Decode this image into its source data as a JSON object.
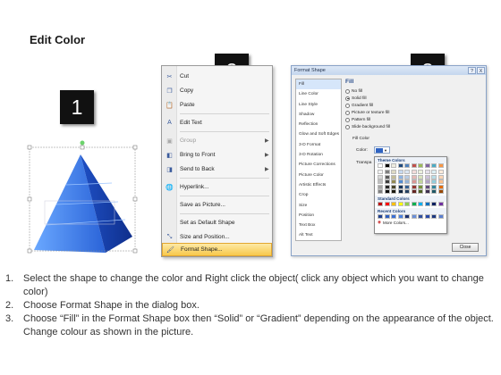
{
  "title": "Edit Color",
  "steps": {
    "one": "1",
    "two": "2",
    "three": "3"
  },
  "context_menu": {
    "items": [
      {
        "label": "Cut",
        "icon": "scissors-icon",
        "disabled": false,
        "submenu": false
      },
      {
        "label": "Copy",
        "icon": "copy-icon",
        "disabled": false,
        "submenu": false
      },
      {
        "label": "Paste",
        "icon": "paste-icon",
        "disabled": false,
        "submenu": false
      },
      {
        "label": "Edit Text",
        "icon": "edit-text-icon",
        "disabled": false,
        "submenu": false
      },
      {
        "label": "Group",
        "icon": "group-icon",
        "disabled": true,
        "submenu": true
      },
      {
        "label": "Bring to Front",
        "icon": "bring-front-icon",
        "disabled": false,
        "submenu": true
      },
      {
        "label": "Send to Back",
        "icon": "send-back-icon",
        "disabled": false,
        "submenu": true
      },
      {
        "label": "Hyperlink...",
        "icon": "hyperlink-icon",
        "disabled": false,
        "submenu": false
      },
      {
        "label": "Save as Picture...",
        "icon": "",
        "disabled": false,
        "submenu": false
      },
      {
        "label": "Set as Default Shape",
        "icon": "",
        "disabled": false,
        "submenu": false
      },
      {
        "label": "Size and Position...",
        "icon": "size-position-icon",
        "disabled": false,
        "submenu": false
      },
      {
        "label": "Format Shape...",
        "icon": "format-shape-icon",
        "disabled": false,
        "submenu": false,
        "highlighted": true
      }
    ]
  },
  "dialog": {
    "title": "Format Shape",
    "help_btn": "?",
    "close_btn": "X",
    "nav": [
      "Fill",
      "Line Color",
      "Line Style",
      "Shadow",
      "Reflection",
      "Glow and Soft Edges",
      "3-D Format",
      "3-D Rotation",
      "Picture Corrections",
      "Picture Color",
      "Artistic Effects",
      "Crop",
      "Size",
      "Position",
      "Text Box",
      "Alt Text"
    ],
    "fill_heading": "Fill",
    "fill_options": [
      "No fill",
      "Solid fill",
      "Gradient fill",
      "Picture or texture fill",
      "Pattern fill",
      "Slide background fill"
    ],
    "fill_selected": 1,
    "fill_color_group": "Fill Color",
    "color_label": "Color:",
    "transparency_label": "Transpa",
    "palette": {
      "theme_heading": "Theme Colors",
      "standard_heading": "Standard Colors",
      "recent_heading": "Recent Colors",
      "more_label": "More Colors...",
      "theme_top": [
        "#ffffff",
        "#000000",
        "#eeece1",
        "#1f497d",
        "#4f81bd",
        "#c0504d",
        "#9bbb59",
        "#8064a2",
        "#4bacc6",
        "#f79646"
      ],
      "theme_shades": [
        [
          "#f2f2f2",
          "#7f7f7f",
          "#ddd9c3",
          "#c6d9f0",
          "#dbe5f1",
          "#f2dcdb",
          "#ebf1dd",
          "#e5e0ec",
          "#dbeef3",
          "#fdeada"
        ],
        [
          "#d8d8d8",
          "#595959",
          "#c4bd97",
          "#8db3e2",
          "#b8cce4",
          "#e5b9b7",
          "#d7e3bc",
          "#ccc1d9",
          "#b7dde8",
          "#fbd5b5"
        ],
        [
          "#bfbfbf",
          "#3f3f3f",
          "#938953",
          "#548dd4",
          "#95b3d7",
          "#d99694",
          "#c3d69b",
          "#b2a2c7",
          "#92cddc",
          "#fac08f"
        ],
        [
          "#a5a5a5",
          "#262626",
          "#494429",
          "#17365d",
          "#366092",
          "#953734",
          "#76923c",
          "#5f497a",
          "#31859b",
          "#e36c09"
        ],
        [
          "#7f7f7f",
          "#0c0c0c",
          "#1d1b10",
          "#0f243e",
          "#244061",
          "#632423",
          "#4f6128",
          "#3f3151",
          "#205867",
          "#974806"
        ]
      ],
      "standard": [
        "#c00000",
        "#ff0000",
        "#ffc000",
        "#ffff00",
        "#92d050",
        "#00b050",
        "#00b0f0",
        "#0070c0",
        "#002060",
        "#7030a0"
      ],
      "recent": [
        "#1f3f8f",
        "#2f5fbf",
        "#3a6fd4",
        "#4a80e0",
        "#1a2f6f",
        "#6a8fd8",
        "#3050a0",
        "#2848a8",
        "#1c3880",
        "#5a7fcf"
      ]
    },
    "close_label": "Close"
  },
  "instructions": [
    {
      "num": "1.",
      "text": "Select the shape to change the color and Right click the object( click any object which you want to change color)"
    },
    {
      "num": "2.",
      "text": "Choose Format Shape in the dialog box."
    },
    {
      "num": "3.",
      "text": "Choose “Fill” in the Format Shape box then “Solid” or “Gradient” depending on the appearance of the object. Change colour as shown in the picture."
    }
  ],
  "colors": {
    "pyramid_dark": "#1a3fa8",
    "pyramid_light": "#7ab0ff",
    "highlight": "#f8c84b",
    "badge": "#111111"
  }
}
